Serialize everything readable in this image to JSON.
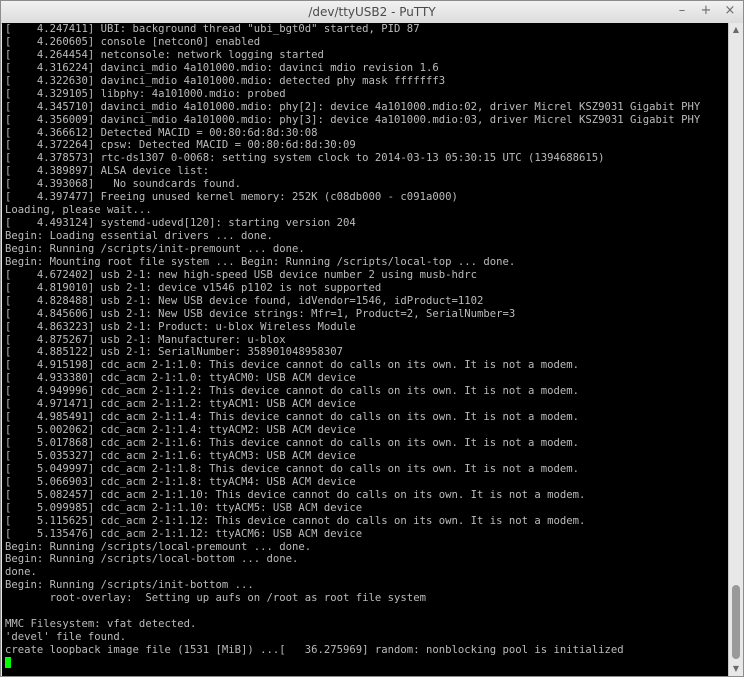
{
  "window": {
    "title": "/dev/ttyUSB2 - PuTTY",
    "minimize_glyph": "–",
    "maximize_glyph": "+",
    "close_glyph": "×"
  },
  "scrollbar": {
    "up_glyph": "▲",
    "down_glyph": "▼"
  },
  "cursor_color": "#00ff00",
  "terminal": {
    "lines": [
      "[    4.247411] UBI: background thread \"ubi_bgt0d\" started, PID 87",
      "[    4.260605] console [netcon0] enabled",
      "[    4.264454] netconsole: network logging started",
      "[    4.316224] davinci_mdio 4a101000.mdio: davinci mdio revision 1.6",
      "[    4.322630] davinci_mdio 4a101000.mdio: detected phy mask fffffff3",
      "[    4.329105] libphy: 4a101000.mdio: probed",
      "[    4.345710] davinci_mdio 4a101000.mdio: phy[2]: device 4a101000.mdio:02, driver Micrel KSZ9031 Gigabit PHY",
      "[    4.356009] davinci_mdio 4a101000.mdio: phy[3]: device 4a101000.mdio:03, driver Micrel KSZ9031 Gigabit PHY",
      "[    4.366612] Detected MACID = 00:80:6d:8d:30:08",
      "[    4.372264] cpsw: Detected MACID = 00:80:6d:8d:30:09",
      "[    4.378573] rtc-ds1307 0-0068: setting system clock to 2014-03-13 05:30:15 UTC (1394688615)",
      "[    4.389897] ALSA device list:",
      "[    4.393068]   No soundcards found.",
      "[    4.397477] Freeing unused kernel memory: 252K (c08db000 - c091a000)",
      "Loading, please wait...",
      "[    4.493124] systemd-udevd[120]: starting version 204",
      "Begin: Loading essential drivers ... done.",
      "Begin: Running /scripts/init-premount ... done.",
      "Begin: Mounting root file system ... Begin: Running /scripts/local-top ... done.",
      "[    4.672402] usb 2-1: new high-speed USB device number 2 using musb-hdrc",
      "[    4.819010] usb 2-1: device v1546 p1102 is not supported",
      "[    4.828488] usb 2-1: New USB device found, idVendor=1546, idProduct=1102",
      "[    4.845606] usb 2-1: New USB device strings: Mfr=1, Product=2, SerialNumber=3",
      "[    4.863223] usb 2-1: Product: u-blox Wireless Module",
      "[    4.875267] usb 2-1: Manufacturer: u-blox",
      "[    4.885122] usb 2-1: SerialNumber: 358901048958307",
      "[    4.915198] cdc_acm 2-1:1.0: This device cannot do calls on its own. It is not a modem.",
      "[    4.933380] cdc_acm 2-1:1.0: ttyACM0: USB ACM device",
      "[    4.949996] cdc_acm 2-1:1.2: This device cannot do calls on its own. It is not a modem.",
      "[    4.971471] cdc_acm 2-1:1.2: ttyACM1: USB ACM device",
      "[    4.985491] cdc_acm 2-1:1.4: This device cannot do calls on its own. It is not a modem.",
      "[    5.002062] cdc_acm 2-1:1.4: ttyACM2: USB ACM device",
      "[    5.017868] cdc_acm 2-1:1.6: This device cannot do calls on its own. It is not a modem.",
      "[    5.035327] cdc_acm 2-1:1.6: ttyACM3: USB ACM device",
      "[    5.049997] cdc_acm 2-1:1.8: This device cannot do calls on its own. It is not a modem.",
      "[    5.066903] cdc_acm 2-1:1.8: ttyACM4: USB ACM device",
      "[    5.082457] cdc_acm 2-1:1.10: This device cannot do calls on its own. It is not a modem.",
      "[    5.099985] cdc_acm 2-1:1.10: ttyACM5: USB ACM device",
      "[    5.115625] cdc_acm 2-1:1.12: This device cannot do calls on its own. It is not a modem.",
      "[    5.135476] cdc_acm 2-1:1.12: ttyACM6: USB ACM device",
      "Begin: Running /scripts/local-premount ... done.",
      "Begin: Running /scripts/local-bottom ... done.",
      "done.",
      "Begin: Running /scripts/init-bottom ...",
      "       root-overlay:  Setting up aufs on /root as root file system",
      "",
      "MMC Filesystem: vfat detected.",
      "'devel' file found.",
      "create loopback image file (1531 [MiB]) ...[   36.275969] random: nonblocking pool is initialized"
    ]
  }
}
